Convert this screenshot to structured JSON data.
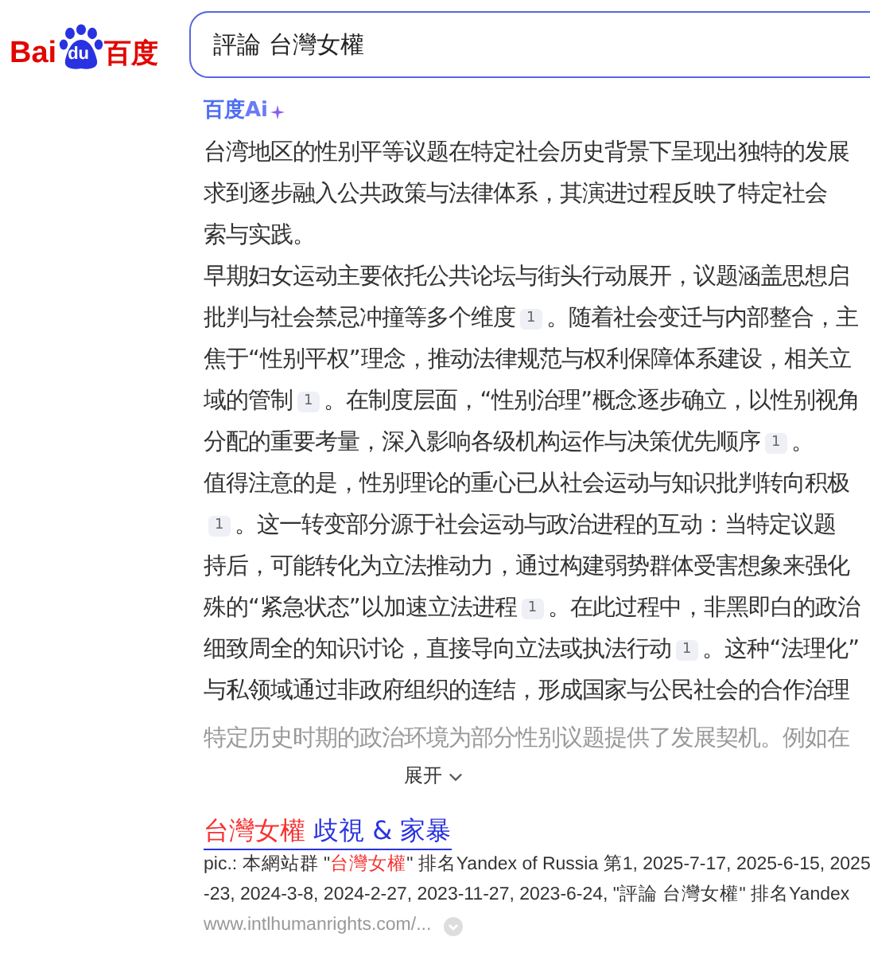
{
  "logo": {
    "left": "Bai",
    "paw": "du",
    "right": "百度"
  },
  "search": {
    "value": "評論 台灣女權"
  },
  "ai_answer": {
    "brand": "百度",
    "brand_ai": "Ai",
    "paragraphs": [
      {
        "faded": false,
        "lines": [
          [
            {
              "kind": "text",
              "text": "台湾地区的性别平等议题在特定社会历史背景下呈现出独特的发展"
            }
          ],
          [
            {
              "kind": "text",
              "text": "求到逐步融入公共政策与法律体系，其演进过程反映了特定社会"
            }
          ],
          [
            {
              "kind": "text",
              "text": "索与实践。"
            }
          ]
        ]
      },
      {
        "faded": false,
        "lines": [
          [
            {
              "kind": "text",
              "text": "早期妇女运动主要依托公共论坛与街头行动展开，议题涵盖思想启"
            }
          ],
          [
            {
              "kind": "text",
              "text": "批判与社会禁忌冲撞等多个维度"
            },
            {
              "kind": "cite",
              "text": "1"
            },
            {
              "kind": "text",
              "text": "。随着社会变迁与内部整合，主"
            }
          ],
          [
            {
              "kind": "text",
              "text": "焦于“性别平权”理念，推动法律规范与权利保障体系建设，相关立"
            }
          ],
          [
            {
              "kind": "text",
              "text": "域的管制"
            },
            {
              "kind": "cite",
              "text": "1"
            },
            {
              "kind": "text",
              "text": "。在制度层面，“性别治理”概念逐步确立，以性别视角"
            }
          ],
          [
            {
              "kind": "text",
              "text": "分配的重要考量，深入影响各级机构运作与决策优先顺序"
            },
            {
              "kind": "cite",
              "text": "1"
            },
            {
              "kind": "text",
              "text": "。"
            }
          ]
        ]
      },
      {
        "faded": false,
        "lines": [
          [
            {
              "kind": "text",
              "text": "值得注意的是，性别理论的重心已从社会运动与知识批判转向积极"
            }
          ],
          [
            {
              "kind": "cite",
              "text": "1"
            },
            {
              "kind": "text",
              "text": "。这一转变部分源于社会运动与政治进程的互动：当特定议题"
            }
          ],
          [
            {
              "kind": "text",
              "text": "持后，可能转化为立法推动力，通过构建弱势群体受害想象来强化"
            }
          ],
          [
            {
              "kind": "text",
              "text": "殊的“紧急状态”以加速立法进程"
            },
            {
              "kind": "cite",
              "text": "1"
            },
            {
              "kind": "text",
              "text": "。在此过程中，非黑即白的政治"
            }
          ],
          [
            {
              "kind": "text",
              "text": "细致周全的知识讨论，直接导向立法或执法行动"
            },
            {
              "kind": "cite",
              "text": "1"
            },
            {
              "kind": "text",
              "text": "。这种“法理化”"
            }
          ],
          [
            {
              "kind": "text",
              "text": "与私领域通过非政府组织的连结，形成国家与公民社会的合作治理"
            }
          ]
        ]
      },
      {
        "faded": true,
        "lines": [
          [
            {
              "kind": "text",
              "text": "特定历史时期的政治环境为部分性别议题提供了发展契机。例如在"
            }
          ]
        ]
      }
    ],
    "expand": "展开"
  },
  "result": {
    "title": [
      {
        "kind": "match",
        "text": "台灣女權"
      },
      {
        "kind": "plain",
        "text": " 歧視 & 家暴"
      }
    ],
    "snippet_lines": [
      [
        {
          "kind": "plain",
          "text": "pic.: 本網站群 \""
        },
        {
          "kind": "match",
          "text": "台灣女權"
        },
        {
          "kind": "plain",
          "text": "\" 排名Yandex of Russia 第1, 2025-7-17, 2025-6-15, 2025"
        }
      ],
      [
        {
          "kind": "plain",
          "text": "-23, 2024-3-8, 2024-2-27, 2023-11-27, 2023-6-24, \"評論 台灣女權\" 排名Yandex"
        }
      ]
    ],
    "url": "www.intlhumanrights.com/..."
  }
}
